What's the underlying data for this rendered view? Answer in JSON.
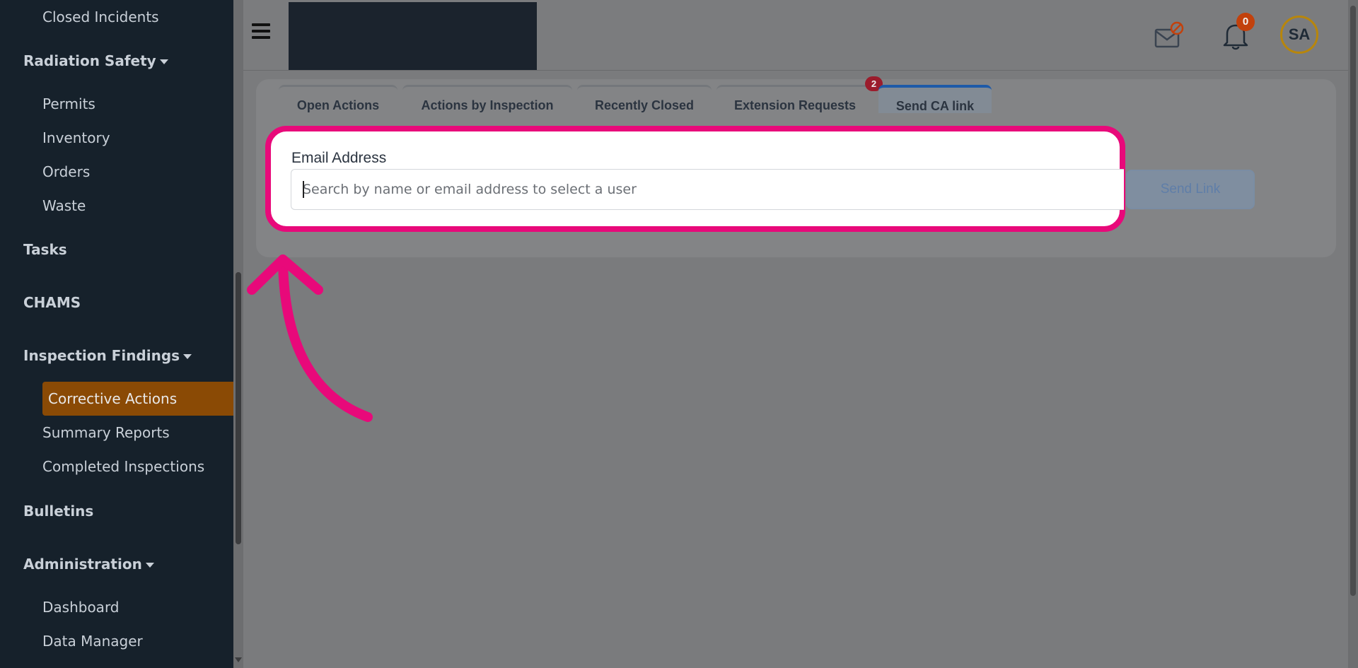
{
  "sidebar": {
    "items": [
      {
        "label": "Closed Incidents"
      },
      {
        "label": "Radiation Safety"
      },
      {
        "label": "Permits"
      },
      {
        "label": "Inventory"
      },
      {
        "label": "Orders"
      },
      {
        "label": "Waste"
      },
      {
        "label": "Tasks"
      },
      {
        "label": "CHAMS"
      },
      {
        "label": "Inspection Findings"
      },
      {
        "label": "Corrective Actions"
      },
      {
        "label": "Summary Reports"
      },
      {
        "label": "Completed Inspections"
      },
      {
        "label": "Bulletins"
      },
      {
        "label": "Administration"
      },
      {
        "label": "Dashboard"
      },
      {
        "label": "Data Manager"
      }
    ],
    "active_color": "#8a4a05"
  },
  "header": {
    "notification_count": "0",
    "avatar_initials": "SA"
  },
  "tabs": [
    {
      "label": "Open Actions"
    },
    {
      "label": "Actions by Inspection"
    },
    {
      "label": "Recently Closed"
    },
    {
      "label": "Extension Requests",
      "badge": "2"
    },
    {
      "label": "Send CA link"
    }
  ],
  "form": {
    "email_label": "Email Address",
    "email_placeholder": "Search by name or email address to select a user",
    "email_value": "",
    "send_label": "Send Link"
  },
  "colors": {
    "highlight": "#e8097a",
    "accent_blue": "#1e5aa8"
  }
}
